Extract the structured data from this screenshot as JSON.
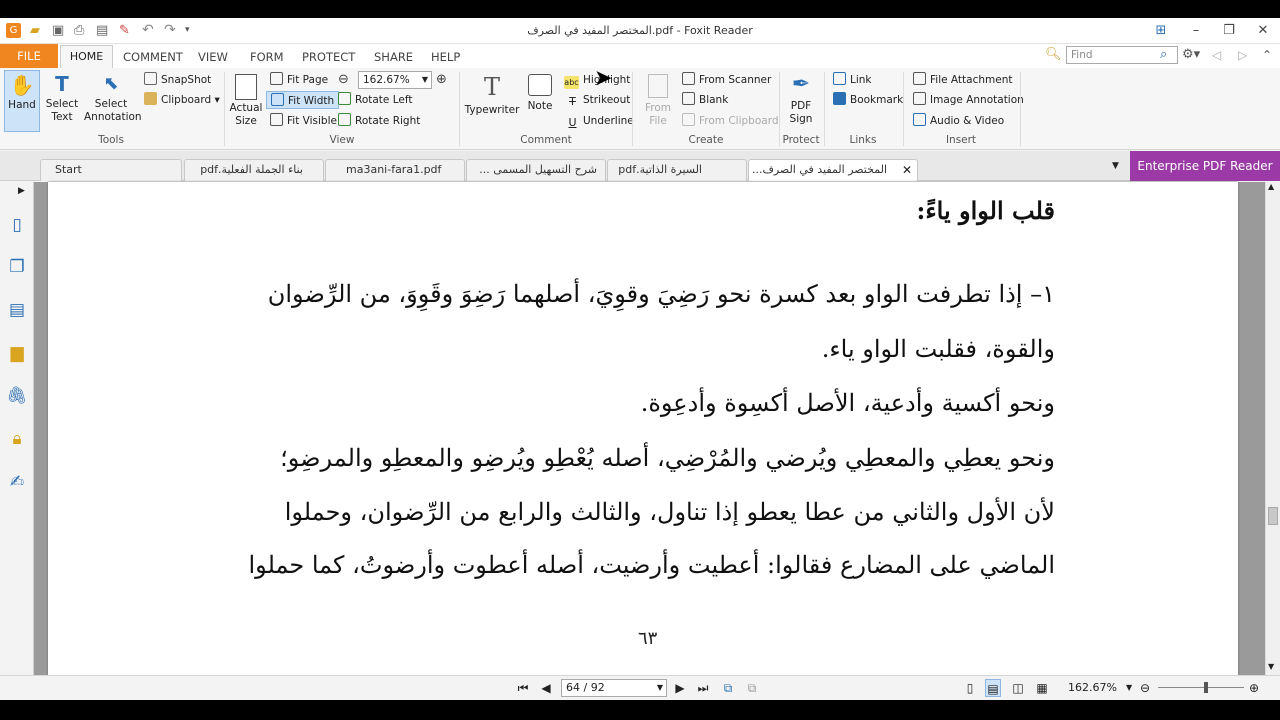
{
  "window": {
    "title": "المختصر المفيد في الصرف.pdf - Foxit Reader"
  },
  "ribbon_tabs": [
    "FILE",
    "HOME",
    "COMMENT",
    "VIEW",
    "FORM",
    "PROTECT",
    "SHARE",
    "HELP"
  ],
  "search": {
    "placeholder": "Find"
  },
  "tools": {
    "hand": "Hand",
    "select_text": "Select Text",
    "select_annotation": "Select Annotation",
    "snapshot": "SnapShot",
    "clipboard": "Clipboard",
    "group": "Tools"
  },
  "view": {
    "actual_size": "Actual Size",
    "fit_page": "Fit Page",
    "fit_width": "Fit Width",
    "fit_visible": "Fit Visible",
    "zoom": "162.67%",
    "rotate_left": "Rotate Left",
    "rotate_right": "Rotate Right",
    "group": "View"
  },
  "comment": {
    "typewriter": "Typewriter",
    "note": "Note",
    "highlight": "Highlight",
    "strikeout": "Strikeout",
    "underline": "Underline",
    "group": "Comment"
  },
  "create": {
    "from_file": "From File",
    "from_scanner": "From Scanner",
    "blank": "Blank",
    "from_clipboard": "From Clipboard",
    "group": "Create"
  },
  "protect": {
    "pdf_sign": "PDF Sign",
    "group": "Protect"
  },
  "links": {
    "link": "Link",
    "bookmark": "Bookmark",
    "group": "Links"
  },
  "insert": {
    "file_attachment": "File Attachment",
    "image_annotation": "Image Annotation",
    "audio_video": "Audio & Video",
    "group": "Insert"
  },
  "doc_tabs": [
    "Start",
    "بناء الجملة الفعلية.pdf",
    "ma3ani-fara1.pdf",
    "شرح التسهيل المسمى ...",
    "السيرة الذاتية.pdf",
    "المختصر المفيد في الصرف..."
  ],
  "banner": "Enterprise PDF Reader",
  "document": {
    "heading": "قلب الواو ياءً:",
    "lines": [
      "١– إذا تطرفت الواو بعد كسرة نحو رَضِيَ وقوِيَ، أصلهما رَضِوَ وقَوِوَ، من الرِّضوان",
      "والقوة، فقلبت الواو ياء.",
      "ونحو أكسية وأدعية، الأصل أكسِوة وأدعِوة.",
      "ونحو يعطِي والمعطِي ويُرضي والمُرْضِي، أصله يُعْطِو ويُرضِو والمعطِو والمرضِو؛",
      "لأن الأول والثاني من عطا يعطو إذا تناول، والثالث والرابع من الرِّضوان، وحملوا",
      "الماضي على المضارع فقالوا: أعطيت وأرضيت، أصله أعطوت وأرضوتُ، كما حملوا"
    ],
    "page_number": "٦٣"
  },
  "status": {
    "page": "64 / 92",
    "zoom": "162.67%"
  }
}
